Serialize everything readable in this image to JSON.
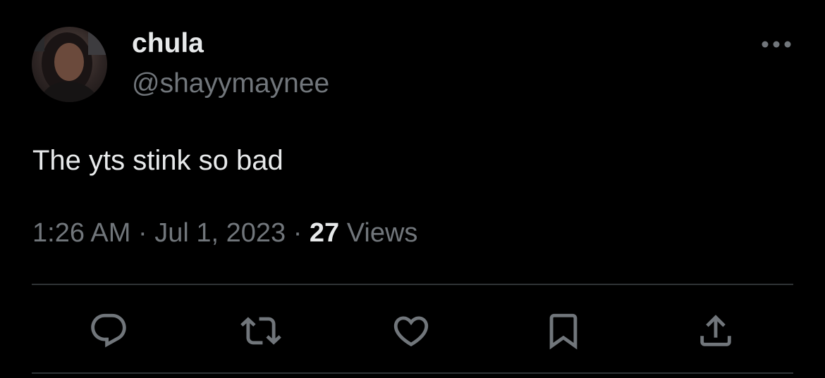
{
  "tweet": {
    "author": {
      "display_name": "chula",
      "handle": "@shayymaynee"
    },
    "text": "The yts stink so bad",
    "time": "1:26 AM",
    "separator": "·",
    "date": "Jul 1, 2023",
    "views_count": "27",
    "views_label": "Views"
  },
  "actions": [
    {
      "name": "reply",
      "icon": "reply-icon"
    },
    {
      "name": "retweet",
      "icon": "retweet-icon"
    },
    {
      "name": "like",
      "icon": "heart-icon"
    },
    {
      "name": "bookmark",
      "icon": "bookmark-icon"
    },
    {
      "name": "share",
      "icon": "share-icon"
    }
  ],
  "colors": {
    "background": "#000000",
    "primary_text": "#e7e9ea",
    "secondary_text": "#71767b",
    "divider": "#2f3336"
  }
}
